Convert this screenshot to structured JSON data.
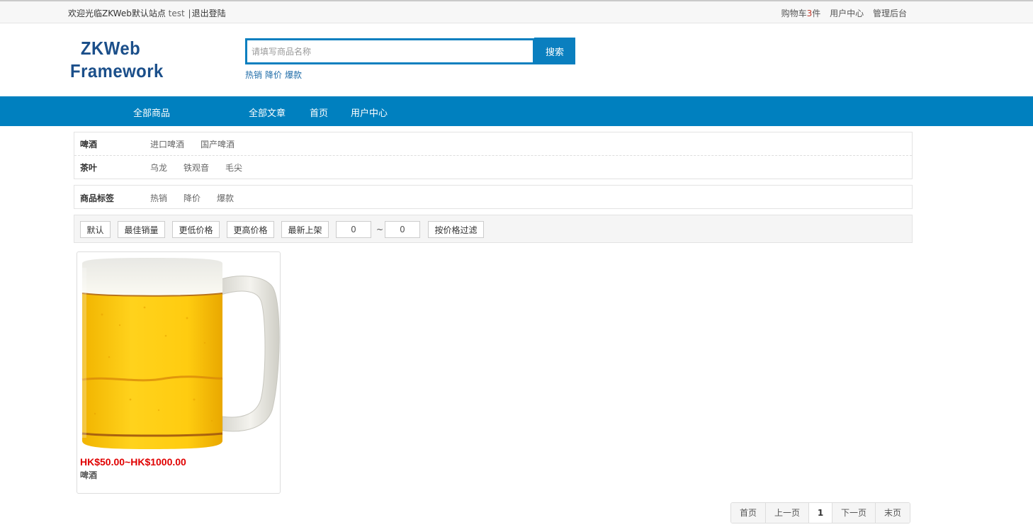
{
  "topbar": {
    "welcome": "欢迎光临ZKWeb默认站点",
    "username": "test",
    "separator": "|",
    "logout": "退出登陆",
    "cart_prefix": "购物车",
    "cart_count": "3",
    "cart_suffix": "件",
    "user_center": "用户中心",
    "admin": "管理后台"
  },
  "logo": {
    "line1": "ZKWeb",
    "line2": "Framework"
  },
  "search": {
    "placeholder": "请填写商品名称",
    "button": "搜索",
    "hot_tags": [
      "热销",
      "降价",
      "爆款"
    ]
  },
  "nav": {
    "items": [
      "全部商品",
      "全部文章",
      "首页",
      "用户中心"
    ]
  },
  "categories": [
    {
      "name": "啤酒",
      "options": [
        "进口啤酒",
        "国产啤酒"
      ]
    },
    {
      "name": "茶叶",
      "options": [
        "乌龙",
        "铁观音",
        "毛尖"
      ]
    }
  ],
  "product_tags": {
    "name": "商品标签",
    "options": [
      "热销",
      "降价",
      "爆款"
    ]
  },
  "sort": {
    "buttons": [
      "默认",
      "最佳销量",
      "更低价格",
      "更高价格",
      "最新上架"
    ],
    "price_min": "0",
    "price_max": "0",
    "range_sep": "~",
    "filter_button": "按价格过滤"
  },
  "products": [
    {
      "price": "HK$50.00~HK$1000.00",
      "name": "啤酒"
    }
  ],
  "pagination": {
    "first": "首页",
    "prev": "上一页",
    "current": "1",
    "next": "下一页",
    "last": "末页"
  },
  "colors": {
    "primary": "#0080bf",
    "price": "#e00000",
    "logo": "#1b4f8a"
  }
}
